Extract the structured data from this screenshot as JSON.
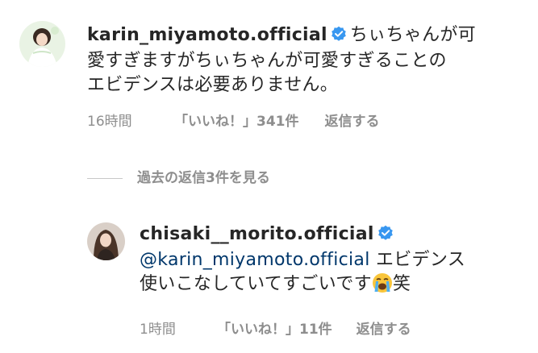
{
  "comment1": {
    "username": "karin_miyamoto.official",
    "text_line1": "ちぃちゃんが可",
    "text_line2": "愛すぎますがちぃちゃんが可愛すぎることの",
    "text_line3": "エビデンスは必要ありません。",
    "time": "16時間",
    "likes": "「いいね！」341件",
    "reply": "返信する"
  },
  "view_replies": "過去の返信3件を見る",
  "comment2": {
    "username": "chisaki__morito.official",
    "mention": "@karin_miyamoto.official",
    "text_line1_rest": "エビデンス",
    "text_line2": "使いこなしていてすごいです",
    "text_line2_suffix": "笑",
    "time": "1時間",
    "likes": "「いいね！」11件",
    "reply": "返信する"
  },
  "colors": {
    "verified": "#3897f0",
    "meta": "#8e8e8e",
    "mention": "#00376b"
  },
  "icons": [
    "verified-badge-icon",
    "crying-face-emoji-icon"
  ]
}
